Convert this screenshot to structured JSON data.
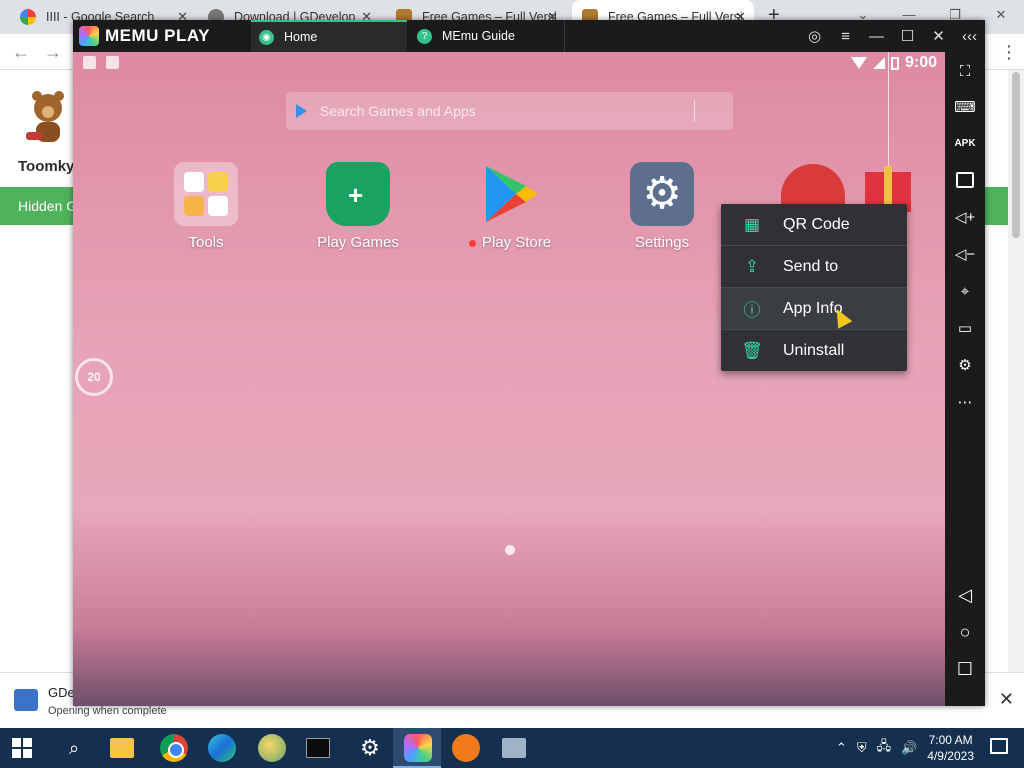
{
  "browser": {
    "tabs": [
      {
        "title": "IIII - Google Search",
        "icon": "google-icon"
      },
      {
        "title": "Download | GDevelop",
        "icon": "globe-icon"
      },
      {
        "title": "Free Games – Full Versi",
        "icon": "site-icon"
      },
      {
        "title": "Free Games – Full Versi",
        "icon": "site-icon"
      }
    ],
    "new_tab": "+",
    "site": {
      "logo_text": "Toomky",
      "green_bar_text": "Hidden G"
    },
    "download": {
      "filename": "GDe",
      "status": "Opening when complete",
      "close": "✕"
    }
  },
  "memu": {
    "brand": "MEMU PLAY",
    "tabs": [
      {
        "label": "Home",
        "icon": "android-icon"
      },
      {
        "label": "MEmu Guide",
        "icon": "help-icon"
      }
    ],
    "status_bar": {
      "time": "9:00"
    },
    "search": {
      "placeholder": "Search Games and Apps"
    },
    "apps": [
      {
        "label": "Tools",
        "icon": "tools-folder-icon"
      },
      {
        "label": "Play Games",
        "icon": "play-games-icon"
      },
      {
        "label": "Play Store",
        "icon": "play-store-icon",
        "new_dot": true
      },
      {
        "label": "Settings",
        "icon": "settings-icon"
      }
    ],
    "context_menu": [
      {
        "label": "QR Code",
        "icon": "qr-code-icon"
      },
      {
        "label": "Send to",
        "icon": "share-icon"
      },
      {
        "label": "App Info",
        "icon": "info-icon"
      },
      {
        "label": "Uninstall",
        "icon": "trash-icon"
      }
    ],
    "floating_badge": "20",
    "accent_color": "#38d6a4"
  },
  "taskbar": {
    "clock_time": "7:00 AM",
    "clock_date": "4/9/2023"
  }
}
